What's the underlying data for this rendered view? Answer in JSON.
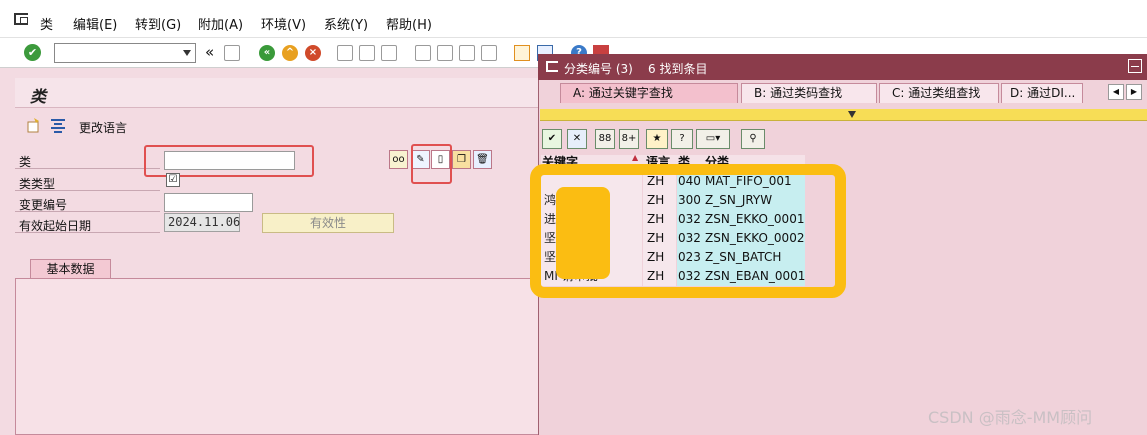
{
  "menubar": {
    "items": [
      "类",
      "编辑(E)",
      "转到(G)",
      "附加(A)",
      "环境(V)",
      "系统(Y)",
      "帮助(H)"
    ]
  },
  "toolbar": {
    "command_value": "",
    "collapse_glyph": "«"
  },
  "page": {
    "title": "类",
    "change_language": "更改语言"
  },
  "form": {
    "class_label": "类",
    "class_value": "",
    "class_type_label": "类类型",
    "change_number_label": "变更编号",
    "change_number_value": "",
    "valid_from_label": "有效起始日期",
    "valid_from_value": "2024.11.06",
    "validity_button": "有效性"
  },
  "tabs": {
    "basic_data": "基本数据"
  },
  "popup": {
    "title": "分类编号 (3)",
    "count": "6 找到条目",
    "tabs": [
      "A: 通过关键字查找",
      "B: 通过类码查找",
      "C: 通过类组查找",
      "D: 通过DI..."
    ],
    "columns": [
      "关键字",
      "语言",
      "类",
      "分类"
    ],
    "rows": [
      {
        "keyword": "",
        "lang": "ZH",
        "type": "040",
        "class": "MAT_FIFO_001"
      },
      {
        "keyword": "鸿",
        "lang": "ZH",
        "type": "300",
        "class": "Z_SN_JRYW"
      },
      {
        "keyword": "进 级审批",
        "lang": "ZH",
        "type": "032",
        "class": "ZSN_EKKO_0001"
      },
      {
        "keyword": "坚 单审批",
        "lang": "ZH",
        "type": "032",
        "class": "ZSN_EKKO_0002"
      },
      {
        "keyword": "坚 次",
        "lang": "ZH",
        "type": "023",
        "class": "Z_SN_BATCH"
      },
      {
        "keyword": "MI 请审批",
        "lang": "ZH",
        "type": "032",
        "class": "ZSN_EBAN_0001"
      }
    ]
  },
  "watermark": "CSDN @雨念-MM顾问",
  "colors": {
    "popup_title_bg": "#8b3c4b",
    "annotation_orange": "#fbbd12",
    "annotation_red": "#e05050",
    "grid_cyan": "#c7eef0"
  }
}
